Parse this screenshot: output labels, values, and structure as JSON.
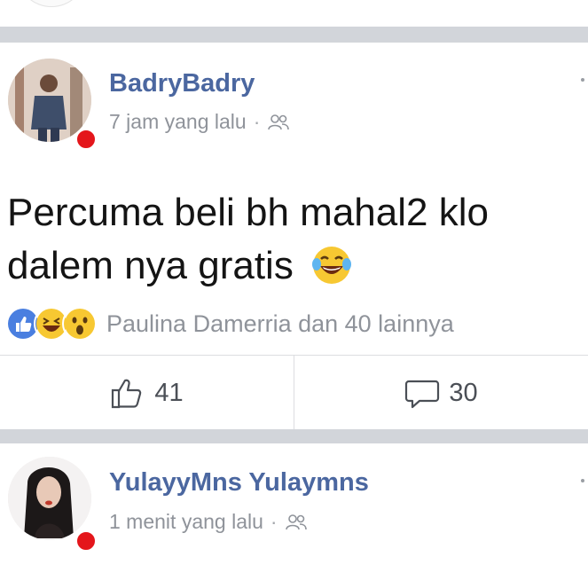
{
  "posts": [
    {
      "author": "BadryBadry",
      "time": "7 jam yang lalu",
      "separator": "·",
      "audience_icon": "friends-icon",
      "text_line1": "Percuma beli bh mahal2 klo",
      "text_line2": "dalem nya gratis",
      "text_emoji": "laughing-tears-emoji",
      "reaction_icons": [
        "like-reaction-icon",
        "haha-reaction-icon",
        "wow-reaction-icon"
      ],
      "reactions_summary": "Paulina Damerria dan 40 lainnya",
      "like_count": "41",
      "comment_count": "30"
    },
    {
      "author": "YulayyMns Yulaymns",
      "time": "1 menit yang lalu",
      "separator": "·",
      "audience_icon": "friends-icon"
    }
  ],
  "colors": {
    "author_name": "#4b67a0",
    "meta_text": "#8f939a",
    "online_dot": "#e4161b",
    "divider": "#d2d5da",
    "like_blue": "#4a7fe0",
    "emoji_yellow": "#f7c832"
  }
}
